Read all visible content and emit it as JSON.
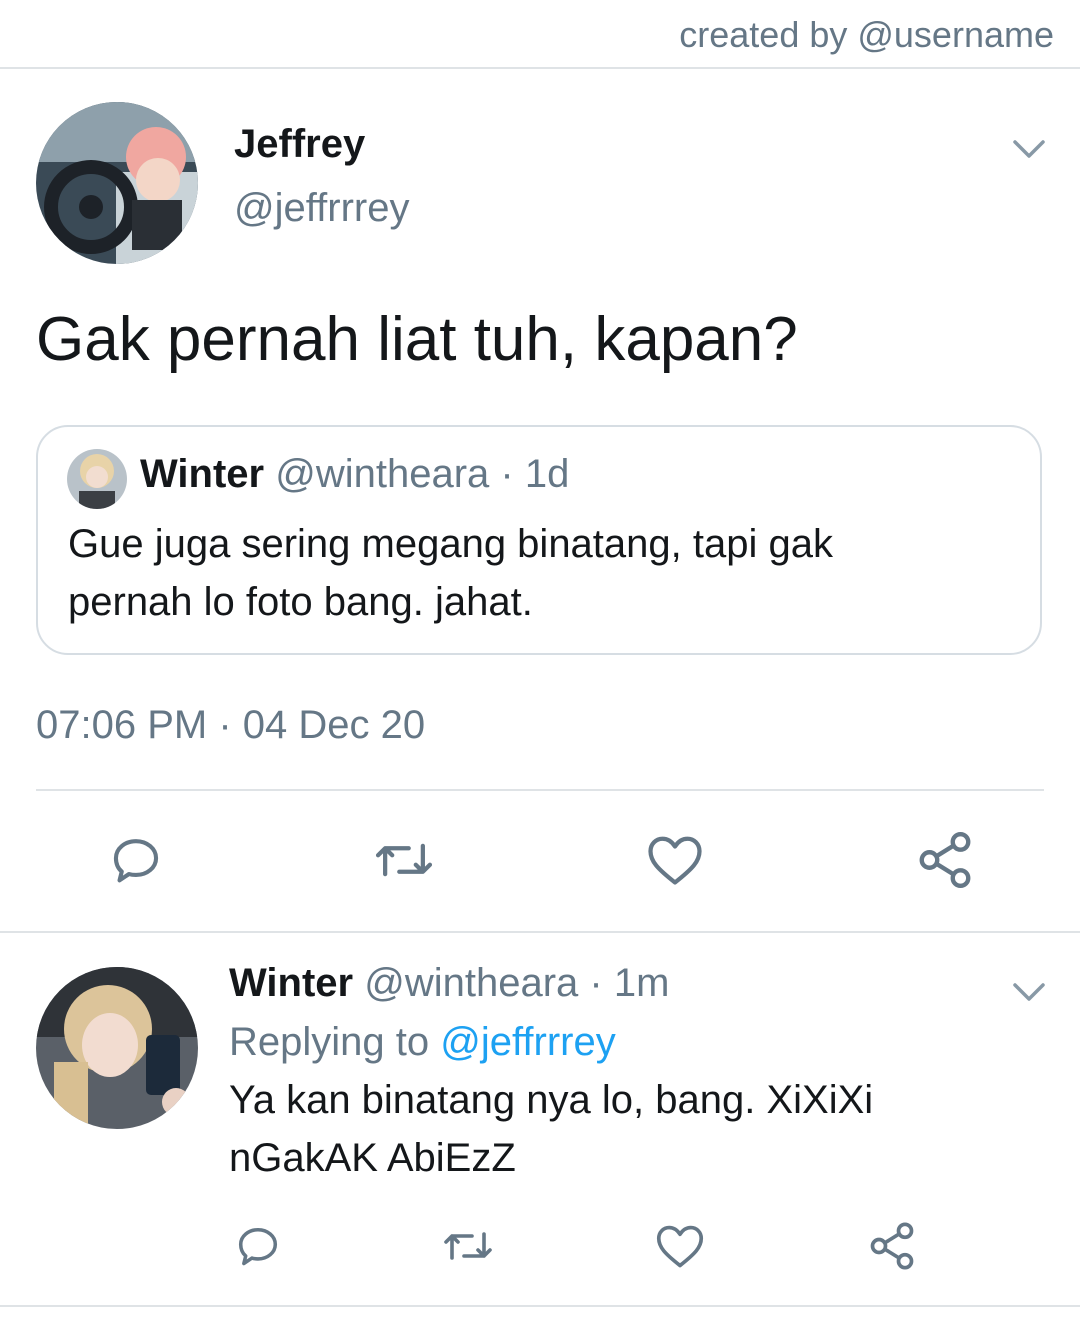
{
  "watermark": "created by @username",
  "tweet": {
    "author_name": "Jeffrey",
    "author_handle": "@jeffrrrey",
    "text": "Gak pernah liat tuh, kapan?",
    "quote": {
      "author_name": "Winter",
      "author_handle": "@wintheara",
      "separator": "·",
      "time": "1d",
      "text": "Gue juga sering megang binatang, tapi gak pernah lo foto bang. jahat."
    },
    "timestamp": "07:06 PM · 04 Dec 20"
  },
  "reply": {
    "author_name": "Winter",
    "author_handle": "@wintheara",
    "separator": "·",
    "time": "1m",
    "replying_label": "Replying to",
    "replying_handle": "@jeffrrrey",
    "text_line1": "Ya kan binatang nya lo, bang. XiXiXi",
    "text_line2": "nGakAK AbiEzZ"
  },
  "icons": {
    "reply": "reply-icon",
    "retweet": "retweet-icon",
    "like": "heart-icon",
    "share": "share-icon",
    "menu": "chevron-down-icon"
  },
  "colors": {
    "text": "#14171a",
    "muted": "#657786",
    "link": "#1da1f2",
    "divider": "#dfe3e6"
  }
}
